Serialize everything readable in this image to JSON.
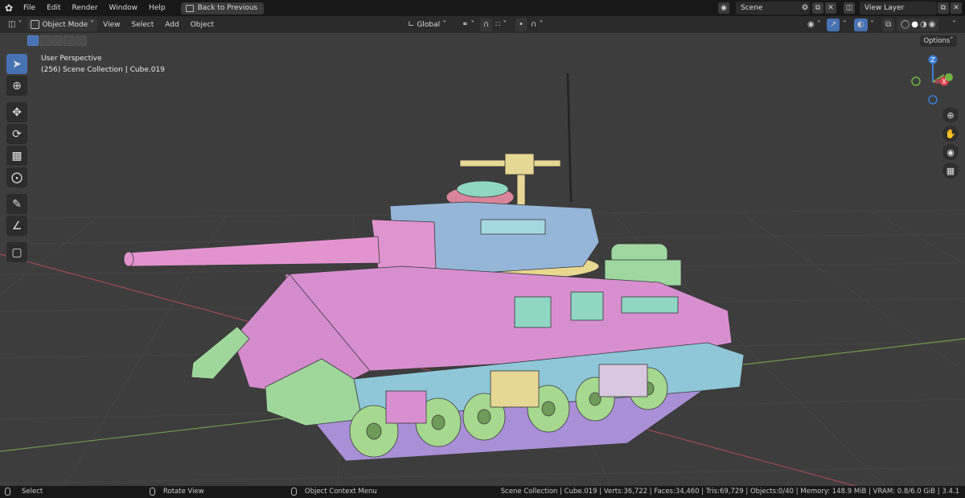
{
  "menu": {
    "items": [
      "File",
      "Edit",
      "Render",
      "Window",
      "Help"
    ],
    "back_button": "Back to Previous",
    "scene": "Scene",
    "view_layer": "View Layer"
  },
  "header": {
    "mode": "Object Mode",
    "menus": [
      "View",
      "Select",
      "Add",
      "Object"
    ],
    "transform_orientation": "Global",
    "options_label": "Options"
  },
  "viewport": {
    "perspective": "User Perspective",
    "collection_info": "(256) Scene Collection | Cube.019",
    "gizmo_axes": {
      "z": "Z",
      "x": "X"
    }
  },
  "toolbar": {
    "tools": [
      "select-box",
      "cursor",
      "move",
      "rotate",
      "scale",
      "transform",
      "annotate",
      "measure",
      "add-cube"
    ]
  },
  "statusbar": {
    "select": "Select",
    "rotate_view": "Rotate View",
    "context_menu": "Object Context Menu",
    "stats": "Scene Collection | Cube.019 | Verts:36,722 | Faces:34,460 | Tris:69,729 | Objects:0/40 | Memory: 148.9 MiB | VRAM: 0.8/6.0 GiB | 3.4.1"
  },
  "colors": {
    "accent": "#4772b3",
    "tank_pink": "#d88fd0",
    "tank_blue": "#8fb6d6",
    "tank_cyan": "#8fd6cc",
    "tank_green": "#9fd79b",
    "tank_yellow": "#e8dc9a",
    "tank_purple": "#b49be0",
    "axis_x": "#e0404f",
    "axis_y": "#70b341",
    "axis_z": "#3a7ed6"
  }
}
